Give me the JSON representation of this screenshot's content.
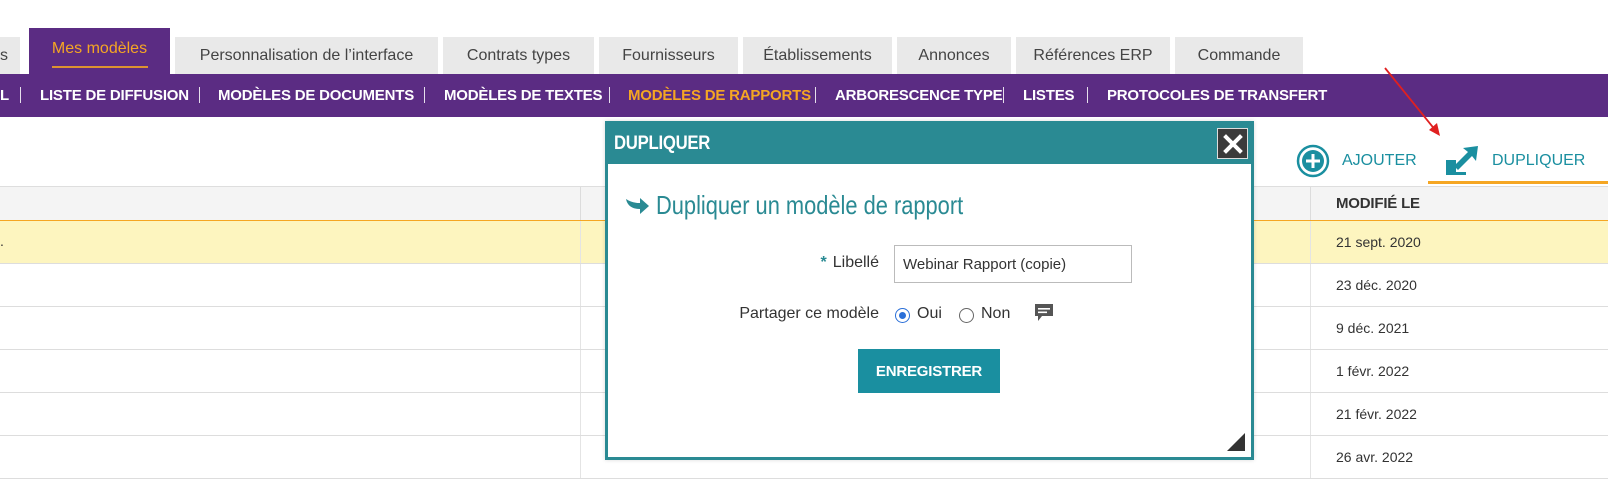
{
  "tabs": [
    {
      "label": "s"
    },
    {
      "label": "Mes modèles",
      "active": true
    },
    {
      "label": "Personnalisation de l’interface"
    },
    {
      "label": "Contrats types"
    },
    {
      "label": "Fournisseurs"
    },
    {
      "label": "Établissements"
    },
    {
      "label": "Annonces"
    },
    {
      "label": "Références ERP"
    },
    {
      "label": "Commande"
    }
  ],
  "subnav": [
    {
      "label": "L"
    },
    {
      "label": "LISTE DE DIFFUSION"
    },
    {
      "label": "MODÈLES DE DOCUMENTS"
    },
    {
      "label": "MODÈLES DE TEXTES"
    },
    {
      "label": "MODÈLES DE RAPPORTS",
      "active": true
    },
    {
      "label": "ARBORESCENCE TYPE"
    },
    {
      "label": "LISTES"
    },
    {
      "label": "PROTOCOLES DE TRANSFERT"
    }
  ],
  "toolbar": {
    "add_label": "AJOUTER",
    "duplicate_label": "DUPLIQUER"
  },
  "table": {
    "modified_header": "MODIFIÉ LE",
    "rows": [
      {
        "prefix": ".",
        "modified": "21 sept. 2020",
        "highlighted": true
      },
      {
        "modified": "23 déc. 2020"
      },
      {
        "modified": "9 déc. 2021"
      },
      {
        "modified": "1 févr. 2022"
      },
      {
        "modified": "21 févr. 2022"
      },
      {
        "modified": "26 avr. 2022"
      }
    ]
  },
  "modal": {
    "title": "DUPLIQUER",
    "heading": "Dupliquer un modèle de rapport",
    "required_marker": "*",
    "label_field": {
      "label": "Libellé",
      "value": "Webinar Rapport (copie)"
    },
    "share": {
      "label": "Partager ce modèle",
      "options": [
        {
          "label": "Oui",
          "checked": true
        },
        {
          "label": "Non",
          "checked": false
        }
      ]
    },
    "save_label": "ENREGISTRER"
  },
  "colors": {
    "purple": "#5b2c83",
    "orange": "#f5a623",
    "teal": "#2a8a93",
    "teal_button": "#1a8fa0",
    "row_highlight": "#fdf5bf"
  }
}
